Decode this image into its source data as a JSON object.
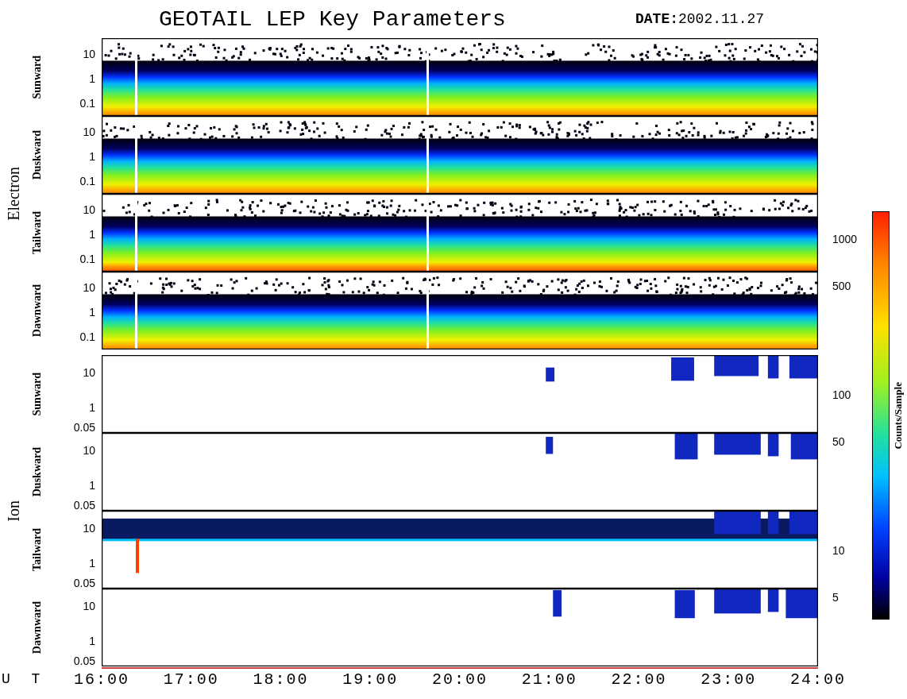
{
  "title": "GEOTAIL LEP Key Parameters",
  "date": "**DATE:**2002.11.27",
  "groups": [
    {
      "name": "Electron",
      "kind": "electron",
      "panels": [
        {
          "label": "Sunward",
          "yticks": [
            "10",
            "1",
            "0.1"
          ]
        },
        {
          "label": "Duskward",
          "yticks": [
            "10",
            "1",
            "0.1"
          ]
        },
        {
          "label": "Tailward",
          "yticks": [
            "10",
            "1",
            "0.1"
          ]
        },
        {
          "label": "Dawnward",
          "yticks": [
            "10",
            "1",
            "0.1"
          ]
        }
      ]
    },
    {
      "name": "Ion",
      "kind": "ion",
      "panels": [
        {
          "label": "Sunward",
          "yticks": [
            "10",
            "1",
            "0.05"
          ]
        },
        {
          "label": "Duskward",
          "yticks": [
            "10",
            "1",
            "0.05"
          ]
        },
        {
          "label": "Tailward",
          "yticks": [
            "10",
            "1",
            "0.05"
          ]
        },
        {
          "label": "Dawnward",
          "yticks": [
            "10",
            "1",
            "0.05"
          ]
        }
      ]
    }
  ],
  "x_axis": {
    "label": "U T",
    "ticks": [
      "16:00",
      "17:00",
      "18:00",
      "19:00",
      "20:00",
      "21:00",
      "22:00",
      "23:00",
      "24:00"
    ]
  },
  "colorbar": {
    "label": "Counts/Sample",
    "ticks": [
      "1000",
      "500",
      "100",
      "50",
      "10",
      "5"
    ]
  }
}
